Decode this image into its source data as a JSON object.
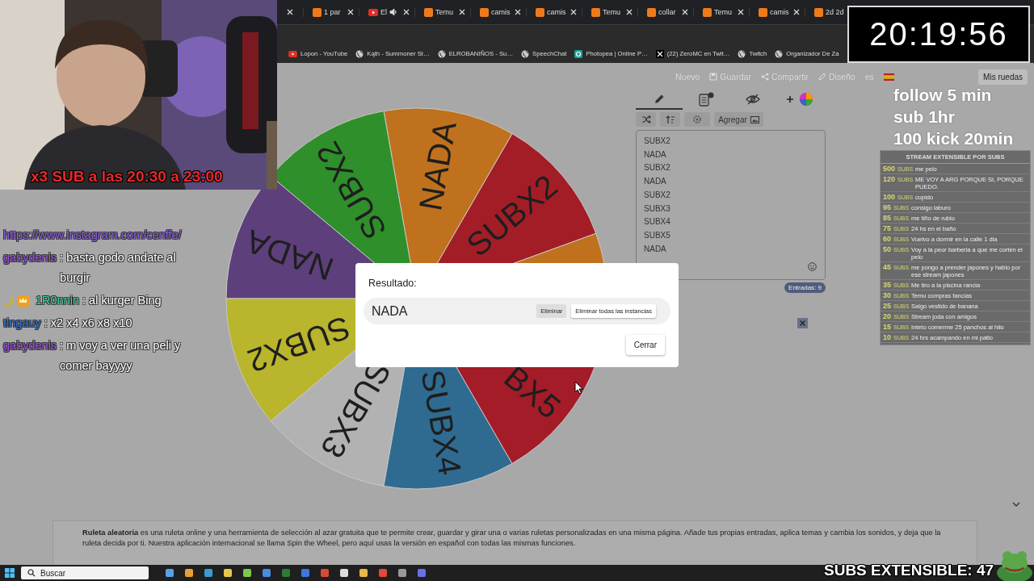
{
  "webcam": {
    "caption": "x3 SUB a las 20:30 a 23:00"
  },
  "browser": {
    "tabs": [
      {
        "title": "1 par",
        "kind": "temu"
      },
      {
        "title": "El",
        "kind": "youtube"
      },
      {
        "title": "Temu",
        "kind": "temu"
      },
      {
        "title": "camis",
        "kind": "temu"
      },
      {
        "title": "camis",
        "kind": "temu"
      },
      {
        "title": "Temu",
        "kind": "temu"
      },
      {
        "title": "collar",
        "kind": "temu"
      },
      {
        "title": "Temu",
        "kind": "temu"
      },
      {
        "title": "camis",
        "kind": "temu"
      },
      {
        "title": "2d 2d",
        "kind": "temu"
      }
    ],
    "bookmarks": [
      {
        "title": "Lopon - YouTube",
        "kind": "youtube"
      },
      {
        "title": "Kąth - Summoner St…",
        "kind": "globe"
      },
      {
        "title": "ELROBANIÑOS - Su…",
        "kind": "globe"
      },
      {
        "title": "SpeechChat",
        "kind": "globe"
      },
      {
        "title": "Photopea | Online P…",
        "kind": "photopea"
      },
      {
        "title": "(22) ZeroMC en Twit…",
        "kind": "x"
      },
      {
        "title": "Twitch",
        "kind": "globe"
      },
      {
        "title": "Organizador De Za",
        "kind": "globe"
      }
    ]
  },
  "toolbar": {
    "items": [
      {
        "label": "Nuevo",
        "kind": "text"
      },
      {
        "label": "Guardar",
        "kind": "save"
      },
      {
        "label": "Compartir",
        "kind": "share"
      },
      {
        "label": "Diseño",
        "kind": "design"
      }
    ],
    "language": "es",
    "my_wheels": "Mis ruedas"
  },
  "wheel": {
    "slices": [
      {
        "label": "SUBX2",
        "color": "#a31d27"
      },
      {
        "label": "NADA",
        "color": "#c0711d"
      },
      {
        "label": "SUBX2",
        "color": "#2f8f2a"
      },
      {
        "label": "NADA",
        "color": "#5d3f7c"
      },
      {
        "label": "SUBX2",
        "color": "#b9b52c"
      },
      {
        "label": "SUBX3",
        "color": "#b2b2b2"
      },
      {
        "label": "SUBX4",
        "color": "#2f6b90"
      },
      {
        "label": "BX5",
        "color": "#a41c28"
      },
      {
        "color": "#c0711d"
      }
    ]
  },
  "editor": {
    "tabs": [
      {
        "kind": "edit",
        "selected": true
      },
      {
        "kind": "results",
        "selected": false
      },
      {
        "kind": "hide",
        "selected": false
      },
      {
        "kind": "add",
        "selected": false
      }
    ],
    "add_label": "Agregar",
    "entries": [
      "SUBX2",
      "NADA",
      "SUBX2",
      "NADA",
      "SUBX2",
      "SUBX3",
      "SUBX4",
      "SUBX5",
      "NADA"
    ],
    "count": "Entradas: 9"
  },
  "dialog": {
    "title": "Resultado:",
    "result": "NADA",
    "remove": "Eliminar",
    "remove_all": "Eliminar todas las instancias",
    "close": "Cerrar"
  },
  "info": {
    "text": "**Ruleta aleatoria** es una ruleta online y una herramienta de selección al azar gratuita que te permite crear, guardar y girar una o varias ruletas personalizadas en una misma página. Añade tus propias entradas, aplica temas y cambia los sonidos, y deja que la ruleta decida por ti. Nuestra aplicación internacional se llama Spin the Wheel, pero aquí usas la versión en español con todas las mismas funciones."
  },
  "timer": "20:19:56",
  "goals": [
    "follow 5 min",
    "sub 1hr",
    "100 kick 20min"
  ],
  "subs_table": {
    "title": "STREAM EXTENSIBLE POR SUBS",
    "rows": [
      {
        "count": "500",
        "unit": "SUBS",
        "text": "me pelo"
      },
      {
        "count": "120",
        "unit": "SUBS",
        "text": "ME VOY A ARG PORQUE SI, PORQUE PUEDO."
      },
      {
        "count": "100",
        "unit": "SUBS",
        "text": "cupido"
      },
      {
        "count": "95",
        "unit": "SUBS",
        "text": "consigo laburo"
      },
      {
        "count": "85",
        "unit": "SUBS",
        "text": "me tiño de rubio"
      },
      {
        "count": "75",
        "unit": "SUBS",
        "text": "24 hs en el baño"
      },
      {
        "count": "60",
        "unit": "SUBS",
        "text": "Vuelvo a dormir en la calle 1 dia"
      },
      {
        "count": "50",
        "unit": "SUBS",
        "text": "Voy a la peor barberia a que me corten el pelo"
      },
      {
        "count": "45",
        "unit": "SUBS",
        "text": "me pongo a prender japones y hablo por ese stream japones"
      },
      {
        "count": "35",
        "unit": "SUBS",
        "text": "Me tiro a la piscina rancia"
      },
      {
        "count": "30",
        "unit": "SUBS",
        "text": "Temu compras fancias"
      },
      {
        "count": "25",
        "unit": "SUBS",
        "text": "Salgo vestido de banana"
      },
      {
        "count": "20",
        "unit": "SUBS",
        "text": "Stream joda con amigos"
      },
      {
        "count": "15",
        "unit": "SUBS",
        "text": "Inteto comerme 25 panchos al hilo"
      },
      {
        "count": "10",
        "unit": "SUBS",
        "text": "24 hrs acampando en mi patio"
      }
    ]
  },
  "chat": [
    {
      "kind": "link",
      "text": "https://www.instagram.com/cenffe/"
    },
    {
      "kind": "message",
      "user": "gabydenis",
      "color": "#9a4fe0",
      "badges": false,
      "text": ": basta godo andate al burgir"
    },
    {
      "kind": "message",
      "user": "1R0nnin",
      "color": "#3fd6a2",
      "badges": true,
      "text": ": al kurger Bing"
    },
    {
      "kind": "message",
      "user": "tingauy",
      "color": "#2f6fd0",
      "badges": false,
      "text": ": x2 x4 x6 x8 x10"
    },
    {
      "kind": "message",
      "user": "gabydenis",
      "color": "#9a4fe0",
      "badges": false,
      "text": ": m voy a ver una peli y comer bayyyy"
    }
  ],
  "subs_counter": "SUBS EXTENSIBLE: 47",
  "taskbar": {
    "search": "Buscar"
  }
}
